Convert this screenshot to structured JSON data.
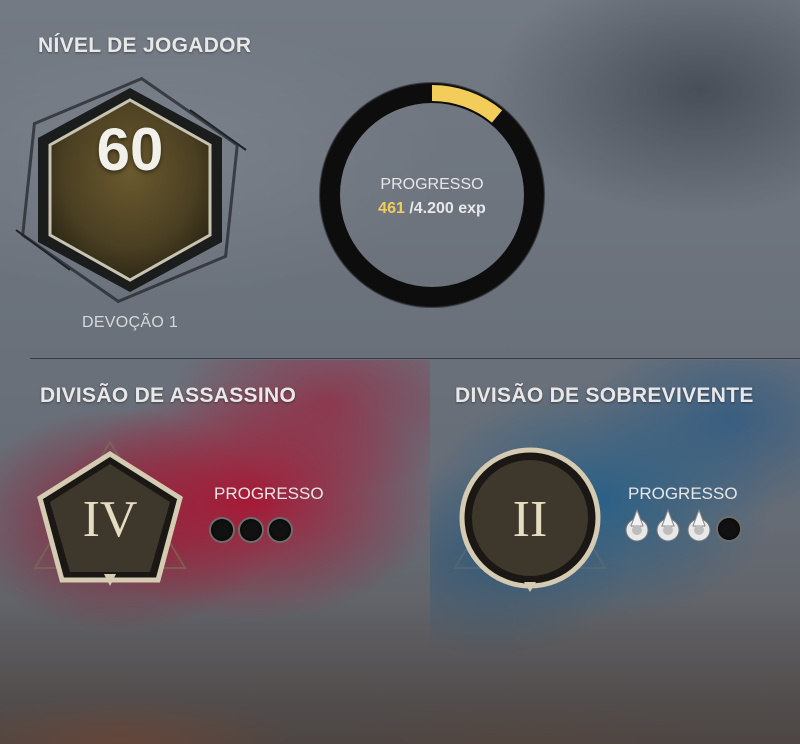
{
  "player_level": {
    "section_title": "NÍVEL DE JOGADOR",
    "level": "60",
    "devotion_label": "DEVOÇÃO 1",
    "progress_label": "PROGRESSO",
    "exp_current": "461",
    "exp_total": "/4.200 exp",
    "progress_fraction": 0.11
  },
  "killer_division": {
    "title": "DIVISÃO DE ASSASSINO",
    "rank_numeral": "IV",
    "progress_label": "PROGRESSO",
    "pips_filled": 0,
    "pips_total": 3
  },
  "survivor_division": {
    "title": "DIVISÃO DE SOBREVIVENTE",
    "rank_numeral": "II",
    "progress_label": "PROGRESSO",
    "pips_filled": 3,
    "pips_total": 4
  },
  "colors": {
    "exp_accent": "#f2cd5a",
    "killer_red": "#aa1432",
    "survivor_blue": "#285f87"
  }
}
